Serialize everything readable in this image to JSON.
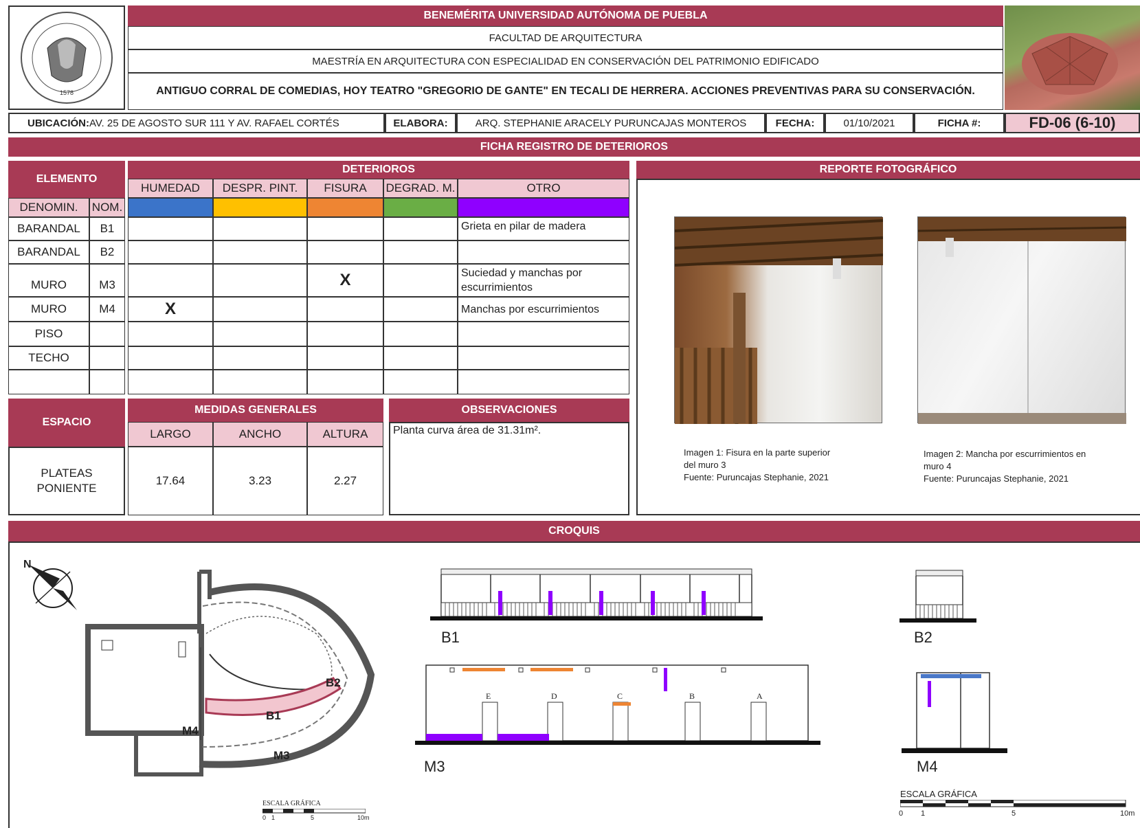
{
  "header": {
    "university": "BENEMÉRITA UNIVERSIDAD AUTÓNOMA DE PUEBLA",
    "faculty": "FACULTAD DE ARQUITECTURA",
    "program": "MAESTRÍA EN  ARQUITECTURA CON ESPECIALIDAD EN CONSERVACIÓN DEL PATRIMONIO EDIFICADO",
    "project": "ANTIGUO CORRAL DE COMEDIAS, HOY TEATRO \"GREGORIO DE GANTE\" EN TECALI DE HERRERA. ACCIONES PREVENTIVAS PARA SU CONSERVACIÓN."
  },
  "info": {
    "ubicacion_label": "UBICACIÓN:",
    "ubicacion_value": " AV. 25 DE AGOSTO SUR 111 Y AV. RAFAEL CORTÉS",
    "elabora_label": "ELABORA:",
    "elabora_value": "ARQ. STEPHANIE ARACELY PURUNCAJAS MONTEROS",
    "fecha_label": "FECHA:",
    "fecha_value": "01/10/2021",
    "ficha_label": "FICHA #:",
    "ficha_value": "FD-06 (6-10)"
  },
  "sheet_title": "FICHA REGISTRO DE DETERIOROS",
  "elemento": {
    "title": "ELEMENTO",
    "col_denomin": "DENOMIN.",
    "col_nom": "NOM."
  },
  "deterioros": {
    "title": "DETERIOROS",
    "columns": [
      "HUMEDAD",
      "DESPR. PINT.",
      "FISURA",
      "DEGRAD. M.",
      "OTRO"
    ],
    "colors": [
      "#3b74c9",
      "#ffc000",
      "#ee8533",
      "#6aae45",
      "#8f00ff"
    ]
  },
  "rows": [
    {
      "denomin": "BARANDAL",
      "nom": "B1",
      "humedad": "",
      "despr": "",
      "fisura": "",
      "degrad": "",
      "otro": "Grieta en pilar de madera"
    },
    {
      "denomin": "BARANDAL",
      "nom": "B2",
      "humedad": "",
      "despr": "",
      "fisura": "",
      "degrad": "",
      "otro": ""
    },
    {
      "denomin": "MURO",
      "nom": "M3",
      "humedad": "",
      "despr": "",
      "fisura": "X",
      "degrad": "",
      "otro": "Suciedad y manchas por escurrimientos"
    },
    {
      "denomin": "MURO",
      "nom": "M4",
      "humedad": "X",
      "despr": "",
      "fisura": "",
      "degrad": "",
      "otro": "Manchas por escurrimientos"
    },
    {
      "denomin": "PISO",
      "nom": "",
      "humedad": "",
      "despr": "",
      "fisura": "",
      "degrad": "",
      "otro": ""
    },
    {
      "denomin": "TECHO",
      "nom": "",
      "humedad": "",
      "despr": "",
      "fisura": "",
      "degrad": "",
      "otro": ""
    },
    {
      "denomin": "",
      "nom": "",
      "humedad": "",
      "despr": "",
      "fisura": "",
      "degrad": "",
      "otro": ""
    }
  ],
  "espacio": {
    "title": "ESPACIO",
    "value": "PLATEAS PONIENTE"
  },
  "medidas": {
    "title": "MEDIDAS GENERALES",
    "largo_label": "LARGO",
    "ancho_label": "ANCHO",
    "altura_label": "ALTURA",
    "largo": "17.64",
    "ancho": "3.23",
    "altura": "2.27"
  },
  "observaciones": {
    "title": "OBSERVACIONES",
    "text": "Planta curva área de 31.31m²."
  },
  "reporte": {
    "title": "REPORTE FOTOGRÁFICO",
    "img1_caption": [
      "Imagen 1:  Fisura en la parte superior",
      "del muro 3",
      "Fuente: Puruncajas Stephanie, 2021"
    ],
    "img2_caption": [
      "Imagen 2: Mancha por escurrimientos en",
      "muro 4",
      "Fuente: Puruncajas Stephanie, 2021"
    ]
  },
  "croquis": {
    "title": "CROQUIS",
    "labels": {
      "b1": "B1",
      "b2": "B2",
      "m3": "M3",
      "m4": "M4"
    },
    "pilares": [
      "E",
      "D",
      "C",
      "B",
      "A"
    ],
    "escala_label": "ESCALA GRÁFICA",
    "escala_label_2": "ESCALA GRÁFICA",
    "escala_ticks_1": [
      "0",
      "1",
      "5",
      "10m"
    ],
    "escala_ticks_2": [
      "0",
      "1",
      "5",
      "10m"
    ]
  },
  "colors": {
    "accent": "#a83a55",
    "light": "#f0c8d2"
  }
}
